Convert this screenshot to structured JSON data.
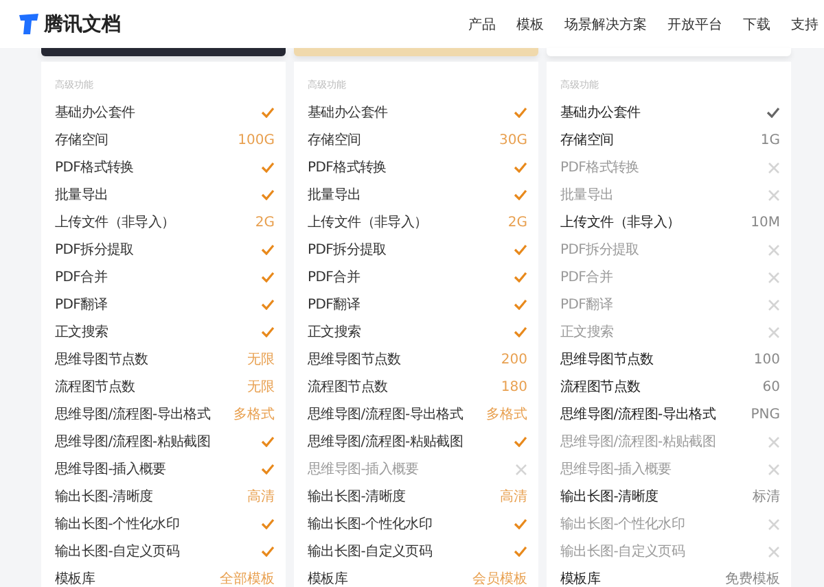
{
  "header": {
    "brand": "腾讯文档",
    "nav": [
      {
        "label": "产品"
      },
      {
        "label": "模板"
      },
      {
        "label": "场景解决方案"
      },
      {
        "label": "开放平台"
      },
      {
        "label": "下载"
      },
      {
        "label": "支持"
      }
    ]
  },
  "plans": [
    {
      "color": "#262833",
      "kind": "paid",
      "section": "高级功能",
      "rows": [
        {
          "label": "基础办公套件",
          "kind": "check"
        },
        {
          "label": "存储空间",
          "kind": "value",
          "value": "100G"
        },
        {
          "label": "PDF格式转换",
          "kind": "check"
        },
        {
          "label": "批量导出",
          "kind": "check"
        },
        {
          "label": "上传文件（非导入）",
          "kind": "value",
          "value": "2G"
        },
        {
          "label": "PDF拆分提取",
          "kind": "check"
        },
        {
          "label": "PDF合并",
          "kind": "check"
        },
        {
          "label": "PDF翻译",
          "kind": "check"
        },
        {
          "label": "正文搜索",
          "kind": "check"
        },
        {
          "label": "思维导图节点数",
          "kind": "value",
          "value": "无限"
        },
        {
          "label": "流程图节点数",
          "kind": "value",
          "value": "无限"
        },
        {
          "label": "思维导图/流程图-导出格式",
          "kind": "value",
          "value": "多格式"
        },
        {
          "label": "思维导图/流程图-粘贴截图",
          "kind": "check"
        },
        {
          "label": "思维导图-插入概要",
          "kind": "check"
        },
        {
          "label": "输出长图-清晰度",
          "kind": "value",
          "value": "高清"
        },
        {
          "label": "输出长图-个性化水印",
          "kind": "check"
        },
        {
          "label": "输出长图-自定义页码",
          "kind": "check"
        },
        {
          "label": "模板库",
          "kind": "value",
          "value": "全部模板"
        }
      ]
    },
    {
      "color": "#f0d9ac",
      "kind": "paid",
      "section": "高级功能",
      "rows": [
        {
          "label": "基础办公套件",
          "kind": "check"
        },
        {
          "label": "存储空间",
          "kind": "value",
          "value": "30G"
        },
        {
          "label": "PDF格式转换",
          "kind": "check"
        },
        {
          "label": "批量导出",
          "kind": "check"
        },
        {
          "label": "上传文件（非导入）",
          "kind": "value",
          "value": "2G"
        },
        {
          "label": "PDF拆分提取",
          "kind": "check"
        },
        {
          "label": "PDF合并",
          "kind": "check"
        },
        {
          "label": "PDF翻译",
          "kind": "check"
        },
        {
          "label": "正文搜索",
          "kind": "check"
        },
        {
          "label": "思维导图节点数",
          "kind": "value",
          "value": "200"
        },
        {
          "label": "流程图节点数",
          "kind": "value",
          "value": "180"
        },
        {
          "label": "思维导图/流程图-导出格式",
          "kind": "value",
          "value": "多格式"
        },
        {
          "label": "思维导图/流程图-粘贴截图",
          "kind": "check"
        },
        {
          "label": "思维导图-插入概要",
          "kind": "cross"
        },
        {
          "label": "输出长图-清晰度",
          "kind": "value",
          "value": "高清"
        },
        {
          "label": "输出长图-个性化水印",
          "kind": "check"
        },
        {
          "label": "输出长图-自定义页码",
          "kind": "check"
        },
        {
          "label": "模板库",
          "kind": "value",
          "value": "会员模板"
        }
      ]
    },
    {
      "color": "#ffffff",
      "kind": "free",
      "section": "高级功能",
      "rows": [
        {
          "label": "基础办公套件",
          "kind": "check"
        },
        {
          "label": "存储空间",
          "kind": "value",
          "value": "1G"
        },
        {
          "label": "PDF格式转换",
          "kind": "cross"
        },
        {
          "label": "批量导出",
          "kind": "cross"
        },
        {
          "label": "上传文件（非导入）",
          "kind": "value",
          "value": "10M"
        },
        {
          "label": "PDF拆分提取",
          "kind": "cross"
        },
        {
          "label": "PDF合并",
          "kind": "cross"
        },
        {
          "label": "PDF翻译",
          "kind": "cross"
        },
        {
          "label": "正文搜索",
          "kind": "cross"
        },
        {
          "label": "思维导图节点数",
          "kind": "value",
          "value": "100"
        },
        {
          "label": "流程图节点数",
          "kind": "value",
          "value": "60"
        },
        {
          "label": "思维导图/流程图-导出格式",
          "kind": "value",
          "value": "PNG"
        },
        {
          "label": "思维导图/流程图-粘贴截图",
          "kind": "cross"
        },
        {
          "label": "思维导图-插入概要",
          "kind": "cross"
        },
        {
          "label": "输出长图-清晰度",
          "kind": "value",
          "value": "标清"
        },
        {
          "label": "输出长图-个性化水印",
          "kind": "cross"
        },
        {
          "label": "输出长图-自定义页码",
          "kind": "cross"
        },
        {
          "label": "模板库",
          "kind": "value",
          "value": "免费模板"
        }
      ]
    }
  ]
}
